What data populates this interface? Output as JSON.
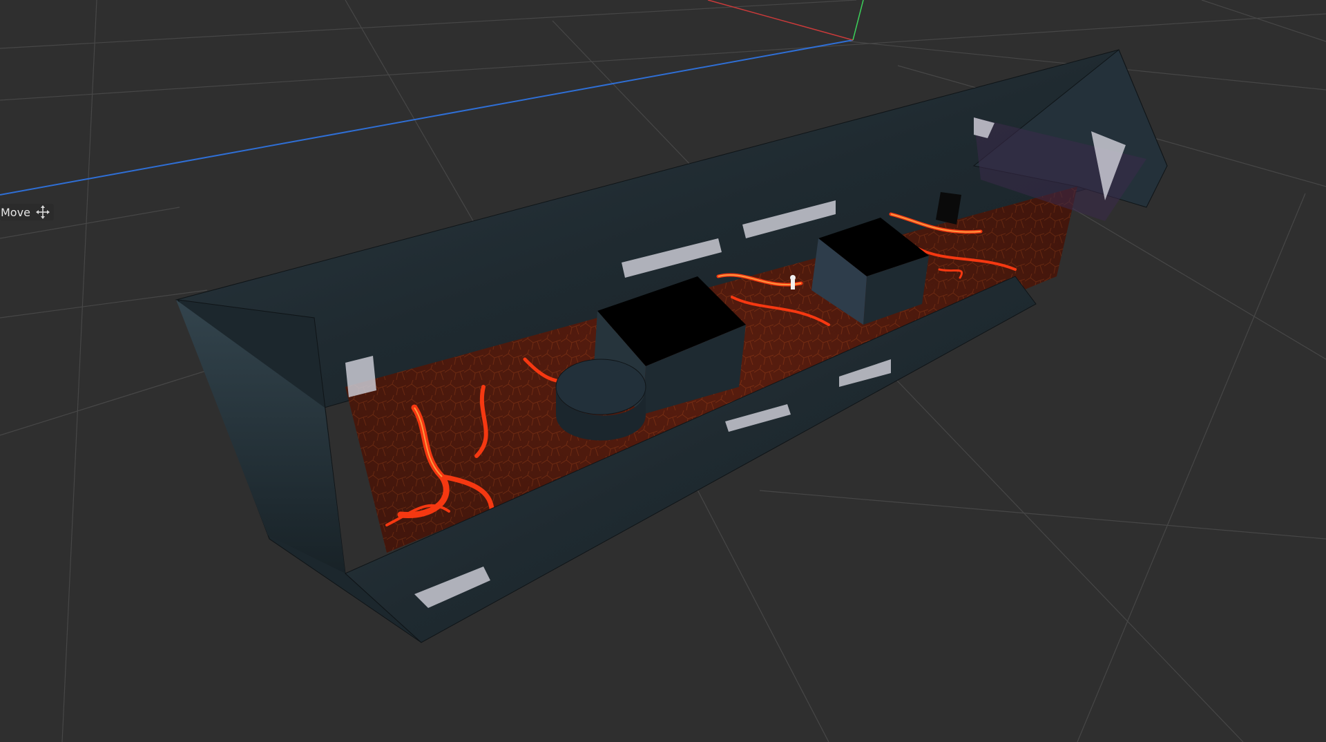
{
  "viewport": {
    "background": "#2f2f2f",
    "grid_color": "#4a4a4a",
    "axis_x_color": "#d43a3a",
    "axis_y_color": "#3ccf5a",
    "axis_z_color": "#2f6fd6"
  },
  "tool_overlay": {
    "label": "Move",
    "icon": "move-arrows-icon"
  },
  "scene": {
    "description_icons": [
      "lava-floor",
      "rock-wall",
      "character-figure"
    ],
    "lava_color": "#ff3a12",
    "lava_dark": "#5a1a0e",
    "rock_color": "#25333b",
    "rock_dark": "#141b20"
  }
}
